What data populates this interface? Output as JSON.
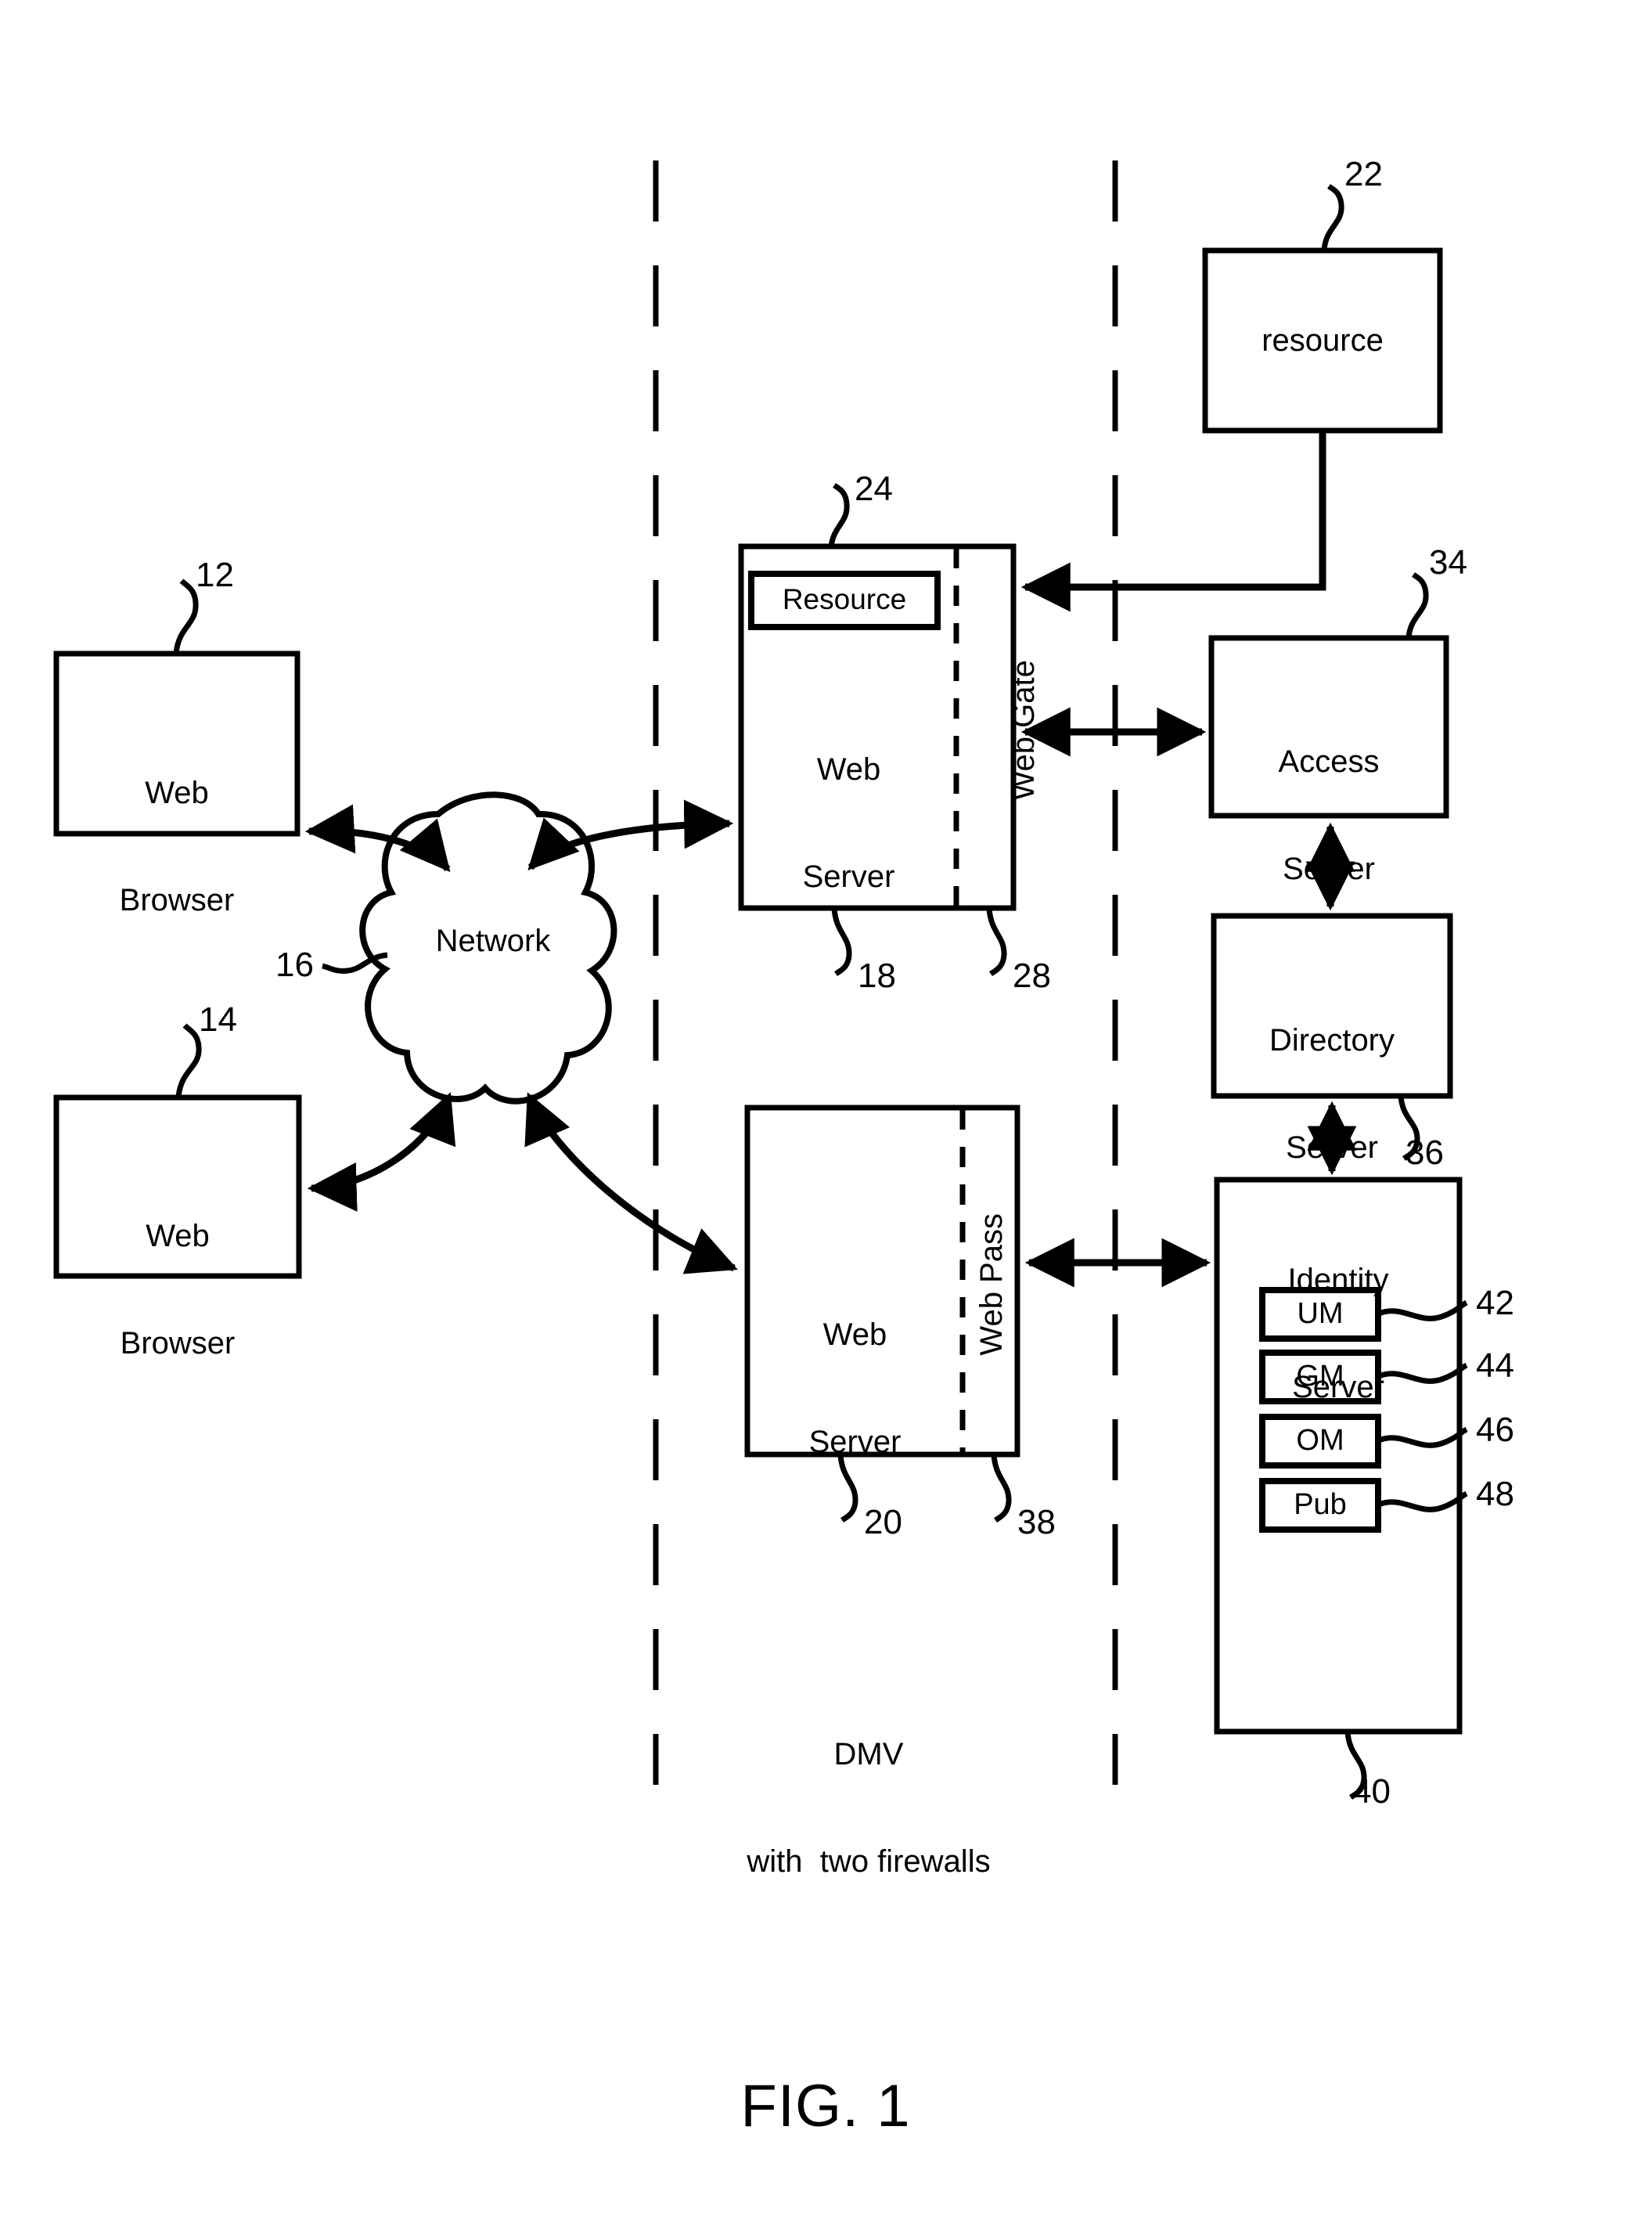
{
  "figure": {
    "caption": "FIG. 1",
    "zone_note_line1": "DMV",
    "zone_note_line2": "with  two firewalls"
  },
  "nodes": {
    "web_browser_top": {
      "label_line1": "Web",
      "label_line2": "Browser",
      "ref": "12"
    },
    "web_browser_bottom": {
      "label_line1": "Web",
      "label_line2": "Browser",
      "ref": "14"
    },
    "network": {
      "label": "Network",
      "ref": "16"
    },
    "web_server_top": {
      "label_line1": "Web",
      "label_line2": "Server",
      "ref": "18"
    },
    "resource_inner": {
      "label": "Resource",
      "ref": "24"
    },
    "web_gate": {
      "label": "Web Gate",
      "ref": "28"
    },
    "web_server_bottom": {
      "label_line1": "Web",
      "label_line2": "Server",
      "ref": "20"
    },
    "web_pass": {
      "label": "Web Pass",
      "ref": "38"
    },
    "resource_external": {
      "label": "resource",
      "ref": "22"
    },
    "access_server": {
      "label_line1": "Access",
      "label_line2": "Server",
      "ref": "34"
    },
    "directory_server": {
      "label_line1": "Directory",
      "label_line2": "Server",
      "ref": "36"
    },
    "identity_server": {
      "label_line1": "Identity",
      "label_line2": "Server",
      "ref": "40"
    },
    "identity_modules": [
      {
        "label": "UM",
        "ref": "42"
      },
      {
        "label": "GM",
        "ref": "44"
      },
      {
        "label": "OM",
        "ref": "46"
      },
      {
        "label": "Pub",
        "ref": "48"
      }
    ]
  },
  "colors": {
    "ink": "#000000",
    "paper": "#ffffff"
  }
}
